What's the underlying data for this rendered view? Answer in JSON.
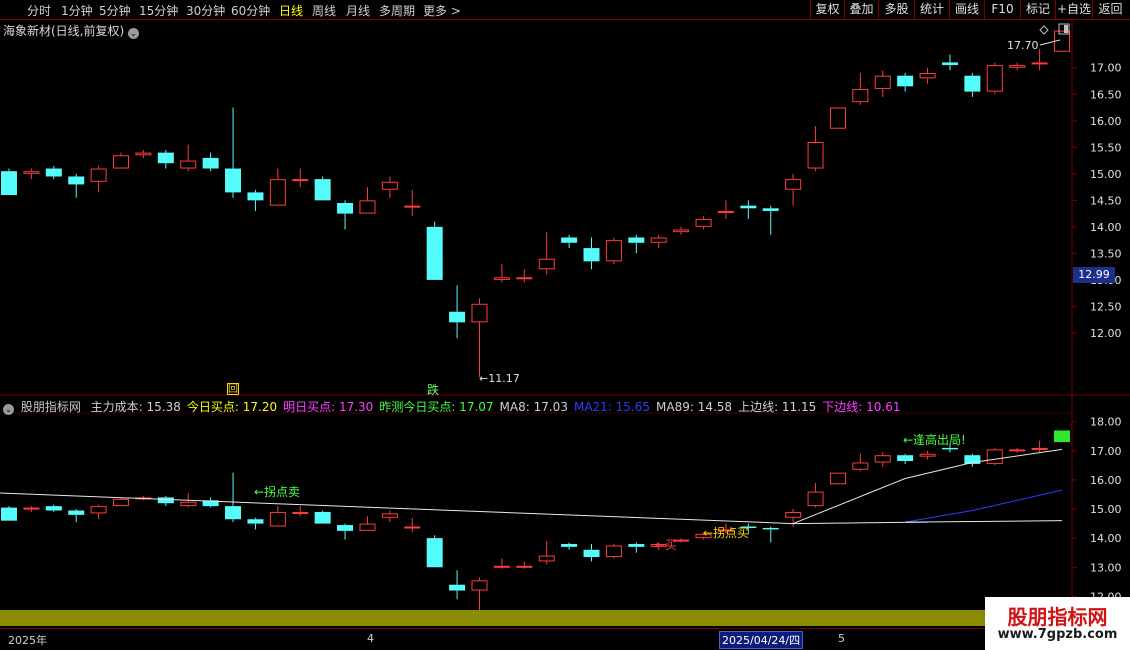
{
  "toolbar": {
    "timeframes": [
      "分时",
      "1分钟",
      "5分钟",
      "15分钟",
      "30分钟",
      "60分钟",
      "日线",
      "周线",
      "月线",
      "多周期",
      "更多 >"
    ],
    "active": "日线",
    "buttons": [
      "复权",
      "叠加",
      "多股",
      "统计",
      "画线",
      "F10",
      "标记",
      "+自选",
      "返回"
    ]
  },
  "title": {
    "text": "海象新材(日线,前复权)"
  },
  "price_axis": [
    "17.00",
    "16.50",
    "16.00",
    "15.50",
    "15.00",
    "14.50",
    "14.00",
    "13.50",
    "13.00",
    "12.50",
    "12.00"
  ],
  "current_price": "12.99",
  "high_label": "17.70",
  "low_label": "←11.17",
  "signals": {
    "hui": "回",
    "die": "跌"
  },
  "legend": {
    "name": "股朋指标网",
    "items": [
      {
        "text": "主力成本: 15.38",
        "color": "#d0d0d0"
      },
      {
        "text": "今日买点: 17.20",
        "color": "#ffff00"
      },
      {
        "text": "明日买点: 17.30",
        "color": "#ff40ff"
      },
      {
        "text": "昨测今日买点: 17.07",
        "color": "#44ff44"
      },
      {
        "text": "MA8: 17.03",
        "color": "#d0d0d0"
      },
      {
        "text": "MA21: 15.65",
        "color": "#2f3cff"
      },
      {
        "text": "MA89: 14.58",
        "color": "#d0d0d0"
      },
      {
        "text": "上边线: 11.15",
        "color": "#d0d0d0"
      },
      {
        "text": "下边线: 10.61",
        "color": "#ff40ff"
      }
    ]
  },
  "indicator_axis": [
    "18.00",
    "17.00",
    "16.00",
    "15.00",
    "14.00",
    "13.00",
    "12.00"
  ],
  "annotations": {
    "sell": "←拐点卖",
    "buy": "←拐点买",
    "buy_red": "←买",
    "top": "←逢高出局!"
  },
  "time_axis": {
    "year": "2025年",
    "m4": "4",
    "m5": "5",
    "cursor": "2025/04/24/四"
  },
  "watermark": {
    "name": "股朋指标网",
    "url": "www.7gpzb.com"
  },
  "colors": {
    "up": "#ff3c3c",
    "down": "#54fcfc",
    "grid": "#7a0000"
  },
  "chart_data": {
    "type": "candlestick",
    "candles": [
      [
        15.05,
        14.6,
        15.1,
        14.6
      ],
      [
        15.0,
        15.05,
        15.1,
        14.9
      ],
      [
        15.1,
        14.95,
        15.15,
        14.9
      ],
      [
        14.95,
        14.8,
        15.0,
        14.55
      ],
      [
        14.85,
        15.1,
        15.15,
        14.65
      ],
      [
        15.1,
        15.35,
        15.4,
        15.1
      ],
      [
        15.35,
        15.4,
        15.45,
        15.3
      ],
      [
        15.4,
        15.2,
        15.45,
        15.1
      ],
      [
        15.1,
        15.25,
        15.55,
        15.05
      ],
      [
        15.3,
        15.1,
        15.4,
        15.05
      ],
      [
        15.1,
        14.65,
        16.25,
        14.55
      ],
      [
        14.65,
        14.5,
        14.7,
        14.3
      ],
      [
        14.4,
        14.9,
        15.1,
        14.4
      ],
      [
        14.9,
        14.9,
        15.1,
        14.75
      ],
      [
        14.9,
        14.5,
        14.95,
        14.5
      ],
      [
        14.45,
        14.25,
        14.5,
        13.95
      ],
      [
        14.25,
        14.5,
        14.75,
        14.25
      ],
      [
        14.7,
        14.85,
        14.95,
        14.55
      ],
      [
        14.4,
        14.4,
        14.7,
        14.2
      ],
      [
        14.0,
        13.0,
        14.1,
        13.0
      ],
      [
        12.4,
        12.2,
        12.9,
        11.9
      ],
      [
        12.2,
        12.55,
        12.65,
        11.17
      ],
      [
        13.0,
        13.05,
        13.3,
        12.95
      ],
      [
        13.05,
        13.05,
        13.2,
        12.95
      ],
      [
        13.2,
        13.4,
        13.9,
        13.1
      ],
      [
        13.8,
        13.7,
        13.85,
        13.6
      ],
      [
        13.6,
        13.35,
        13.8,
        13.2
      ],
      [
        13.35,
        13.75,
        13.8,
        13.3
      ],
      [
        13.8,
        13.7,
        13.85,
        13.5
      ],
      [
        13.7,
        13.8,
        13.85,
        13.6
      ],
      [
        13.9,
        13.95,
        14.0,
        13.85
      ],
      [
        14.0,
        14.15,
        14.2,
        13.95
      ],
      [
        14.3,
        14.3,
        14.5,
        14.15
      ],
      [
        14.4,
        14.35,
        14.5,
        14.15
      ],
      [
        14.35,
        14.3,
        14.4,
        13.85
      ],
      [
        14.7,
        14.9,
        15.0,
        14.4
      ],
      [
        15.1,
        15.6,
        15.9,
        15.05
      ],
      [
        15.85,
        16.25,
        16.25,
        15.85
      ],
      [
        16.35,
        16.6,
        16.9,
        16.3
      ],
      [
        16.6,
        16.85,
        16.95,
        16.45
      ],
      [
        16.85,
        16.65,
        16.9,
        16.55
      ],
      [
        16.8,
        16.9,
        17.0,
        16.7
      ],
      [
        17.1,
        17.05,
        17.25,
        16.95
      ],
      [
        16.85,
        16.55,
        16.9,
        16.45
      ],
      [
        16.55,
        17.05,
        17.1,
        16.5
      ],
      [
        17.0,
        17.05,
        17.1,
        16.95
      ],
      [
        17.1,
        17.1,
        17.35,
        16.95
      ],
      [
        17.3,
        17.7,
        17.7,
        17.3
      ]
    ],
    "cost_line": {
      "start": 15.55,
      "end": 14.5
    },
    "ma89_levels": [
      14.6,
      14.55
    ],
    "price_range": [
      11.0,
      17.9
    ],
    "indicator_range": [
      11.6,
      18.3
    ],
    "xlabel": "",
    "ylabel": ""
  }
}
